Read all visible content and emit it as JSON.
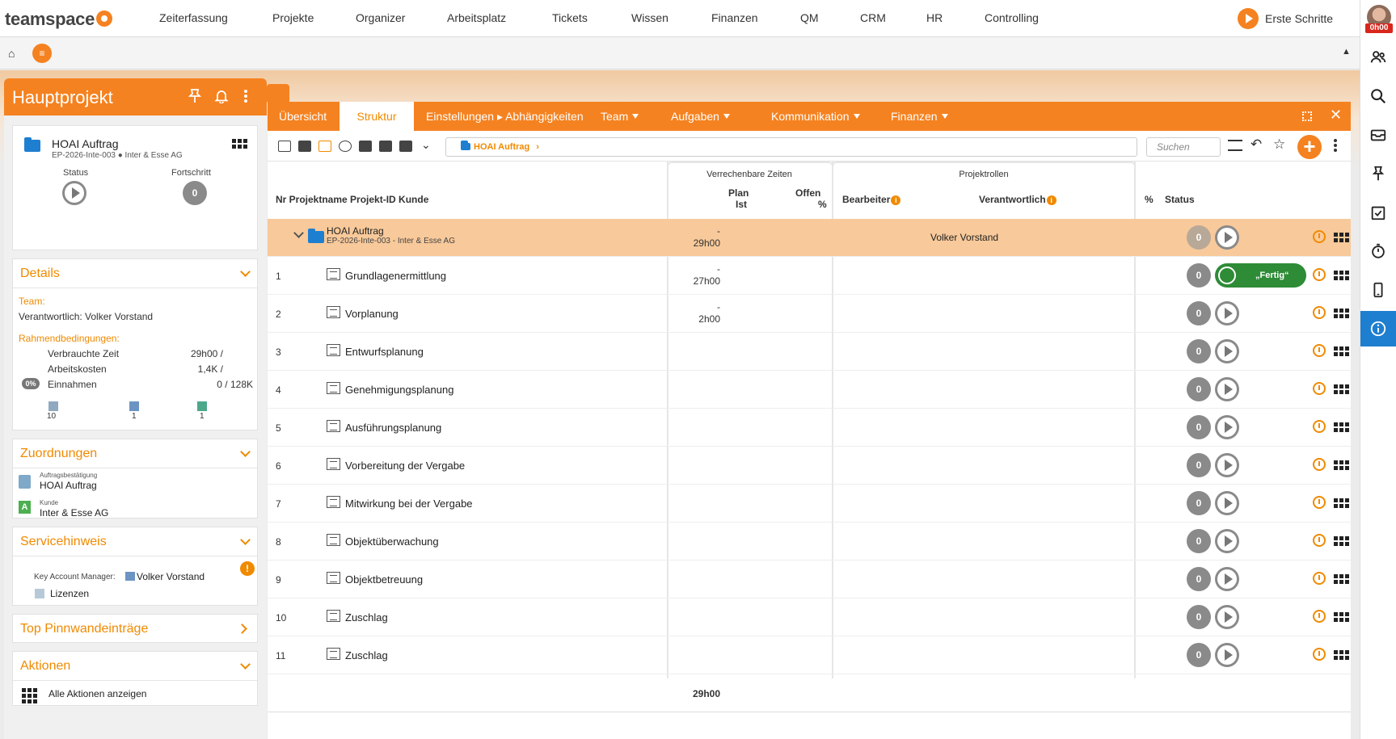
{
  "brand": "teamspace",
  "nav": [
    "Zeiterfassung",
    "Projekte",
    "Organizer",
    "Arbeitsplatz",
    "Tickets",
    "Wissen",
    "Finanzen",
    "QM",
    "CRM",
    "HR",
    "Controlling"
  ],
  "first_steps": "Erste Schritte",
  "user_time": "0h00",
  "left": {
    "title": "Hauptprojekt",
    "project_name": "HOAI Auftrag",
    "project_sub": "EP-2026-Inte-003 ● Inter & Esse AG",
    "status_label": "Status",
    "progress_label": "Fortschritt",
    "progress_value": "0",
    "details_title": "Details",
    "team_label": "Team:",
    "responsible": "Verantwortlich: Volker Vorstand",
    "conditions_label": "Rahmendbedingungen:",
    "rows": [
      {
        "label": "Verbrauchte Zeit",
        "value": "29h00 /"
      },
      {
        "label": "Arbeitskosten",
        "value": "1,4K /"
      },
      {
        "label": "Einnahmen",
        "value": "0 /  128K"
      }
    ],
    "pct_badge": "0%",
    "counts": [
      "10",
      "1",
      "1"
    ],
    "assign_title": "Zuordnungen",
    "assign1_small": "Auftragsbestätigung",
    "assign1": "HOAI Auftrag",
    "assign2_small": "Kunde",
    "assign2": "Inter & Esse AG",
    "service_title": "Servicehinweis",
    "kam_label": "Key Account Manager:",
    "kam_name": "Volker Vorstand",
    "licenses": "Lizenzen",
    "pin_title": "Top Pinnwandeinträge",
    "actions_title": "Aktionen",
    "actions_all": "Alle Aktionen anzeigen"
  },
  "tabs": [
    "Übersicht",
    "Struktur",
    "Einstellungen ▸ Abhängigkeiten",
    "Team",
    "Aufgaben",
    "Kommunikation",
    "Finanzen"
  ],
  "breadcrumb": "HOAI Auftrag",
  "search_placeholder": "Suchen",
  "table": {
    "group_times": "Verrechenbare Zeiten",
    "group_roles": "Projektrollen",
    "h_main": "Nr Projektname Projekt-ID Kunde",
    "h_plan": "Plan",
    "h_ist": "Ist",
    "h_offen": "Offen",
    "h_pct_small": "%",
    "h_bearbeiter": "Bearbeiter",
    "h_verantwortlich": "Verantwortlich",
    "h_pct": "%",
    "h_status": "Status",
    "parent": {
      "name": "HOAI Auftrag",
      "sub": "EP-2026-Inte-003 - Inter & Esse AG",
      "plan": "-",
      "ist": "29h00",
      "responsible": "Volker Vorstand",
      "pct": "0"
    },
    "rows": [
      {
        "nr": "1",
        "name": "Grundlagenermittlung",
        "plan": "-",
        "ist": "27h00",
        "pct": "0",
        "done": "„Fertig“"
      },
      {
        "nr": "2",
        "name": "Vorplanung",
        "plan": "-",
        "ist": "2h00",
        "pct": "0"
      },
      {
        "nr": "3",
        "name": "Entwurfsplanung",
        "pct": "0"
      },
      {
        "nr": "4",
        "name": "Genehmigungsplanung",
        "pct": "0"
      },
      {
        "nr": "5",
        "name": "Ausführungsplanung",
        "pct": "0"
      },
      {
        "nr": "6",
        "name": "Vorbereitung der Vergabe",
        "pct": "0"
      },
      {
        "nr": "7",
        "name": "Mitwirkung bei der Vergabe",
        "pct": "0"
      },
      {
        "nr": "8",
        "name": "Objektüberwachung",
        "pct": "0"
      },
      {
        "nr": "9",
        "name": "Objektbetreuung",
        "pct": "0"
      },
      {
        "nr": "10",
        "name": "Zuschlag",
        "pct": "0"
      },
      {
        "nr": "11",
        "name": "Zuschlag",
        "pct": "0"
      }
    ],
    "total": "29h00"
  }
}
